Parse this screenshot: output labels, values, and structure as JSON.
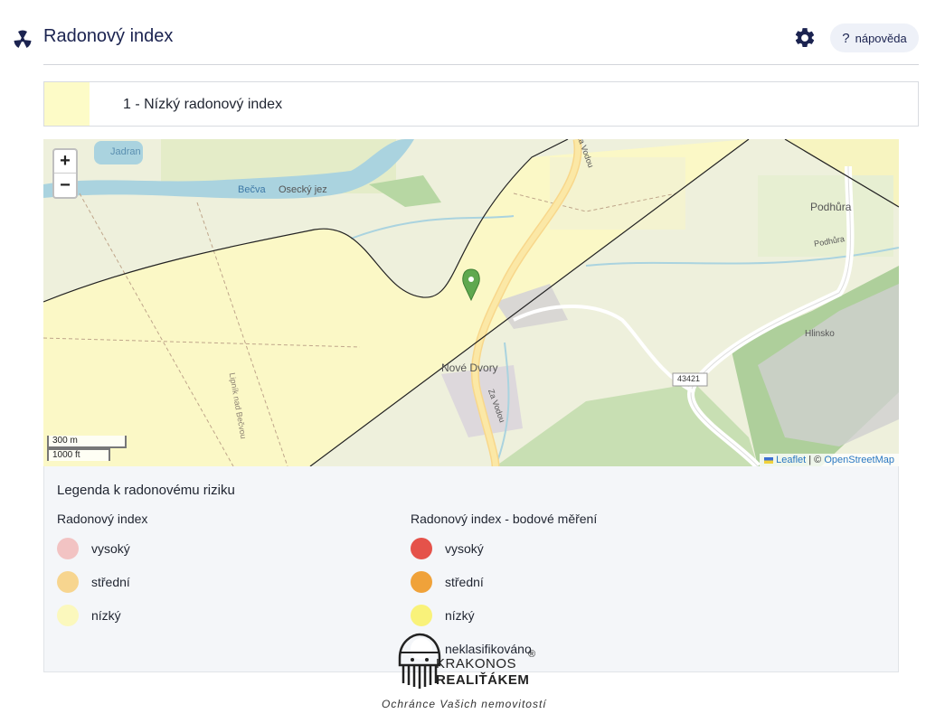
{
  "header": {
    "title": "Radonový index",
    "help_label": "nápověda",
    "help_glyph": "?",
    "logo_icon": "radiation-icon",
    "settings_icon": "gear-icon"
  },
  "index_box": {
    "label": "1 - Nízký radonový index",
    "swatch_color": "#fdfbc7"
  },
  "map": {
    "zoom_in": "+",
    "zoom_out": "−",
    "scale_metric": "300 m",
    "scale_imperial": "1000 ft",
    "attribution_leaflet": "Leaflet",
    "attribution_sep": " | © ",
    "attribution_osm": "OpenStreetMap",
    "places": {
      "jadran": "Jadran",
      "becva": "Bečva",
      "osecky_jez": "Osecký jez",
      "za_vodou_1": "Za Vodou",
      "za_vodou_2": "Za Vodou",
      "podhura": "Podhůra",
      "podhura_street": "Podhůra",
      "nove_dvory": "Nové Dvory",
      "hlinsko": "Hlinsko",
      "road_number": "43421",
      "lipnik": "Lipník nad Bečvou"
    }
  },
  "legend": {
    "title": "Legenda k radonovému riziku",
    "col1": {
      "title": "Radonový index",
      "items": [
        {
          "label": "vysoký",
          "color": "#f2c3c3"
        },
        {
          "label": "střední",
          "color": "#f7d58f"
        },
        {
          "label": "nízký",
          "color": "#fbf8bd"
        }
      ]
    },
    "col2": {
      "title": "Radonový index - bodové měření",
      "items": [
        {
          "label": "vysoký",
          "color": "#e5524a"
        },
        {
          "label": "střední",
          "color": "#f0a23a"
        },
        {
          "label": "nízký",
          "color": "#f9f27a"
        },
        {
          "label": "neklasifikováno",
          "color": "#ffffff"
        }
      ]
    }
  },
  "watermark": {
    "line1": "KRAKONOS",
    "line2": "REALIŤÁKEM",
    "reg": "®",
    "motto": "Ochránce Vašich nemovitostí"
  }
}
